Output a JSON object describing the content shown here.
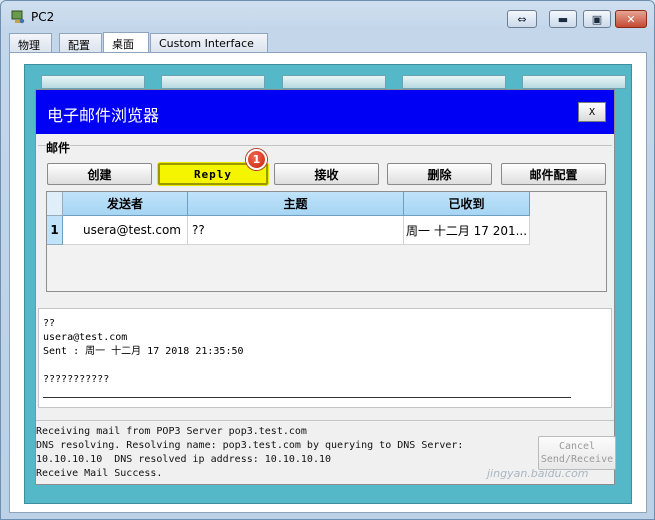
{
  "window": {
    "title": "PC2",
    "swap_glyph": "⇔",
    "min_glyph": "▬",
    "max_glyph": "▣",
    "close_glyph": "✕"
  },
  "tabs": [
    {
      "label": "物理",
      "active": false
    },
    {
      "label": "配置",
      "active": false
    },
    {
      "label": "桌面",
      "active": true
    },
    {
      "label": "Custom Interface",
      "active": false
    }
  ],
  "mail": {
    "title": "电子邮件浏览器",
    "close_label": "X",
    "group_label": "邮件",
    "buttons": {
      "create": "创建",
      "reply": "Reply",
      "receive": "接收",
      "delete": "删除",
      "config": "邮件配置"
    },
    "badge": "1",
    "table": {
      "headers": [
        "发送者",
        "主题",
        "已收到"
      ],
      "rows": [
        {
          "index": "1",
          "sender": "usera@test.com",
          "subject": "??",
          "received": "周一 十二月 17 201..."
        }
      ]
    },
    "message": {
      "subject": "??",
      "from": "usera@test.com",
      "sent": "Sent : 周一 十二月 17 2018 21:35:50",
      "body": "???????????"
    },
    "status_lines": [
      "Receiving mail from POP3 Server pop3.test.com",
      "DNS resolving. Resolving name: pop3.test.com by querying to DNS Server:",
      "10.10.10.10  DNS resolved ip address: 10.10.10.10",
      "Receive Mail Success."
    ],
    "cancel_label": "Cancel",
    "send_receive_label": "Send/Receive"
  },
  "watermark": "jingyan.baidu.com",
  "colors": {
    "accent": "#0000f5",
    "reply_highlight": "#f5f500",
    "badge": "#d9301a",
    "desktop": "#55b8c8"
  },
  "icons": {
    "app": "pc-icon"
  }
}
